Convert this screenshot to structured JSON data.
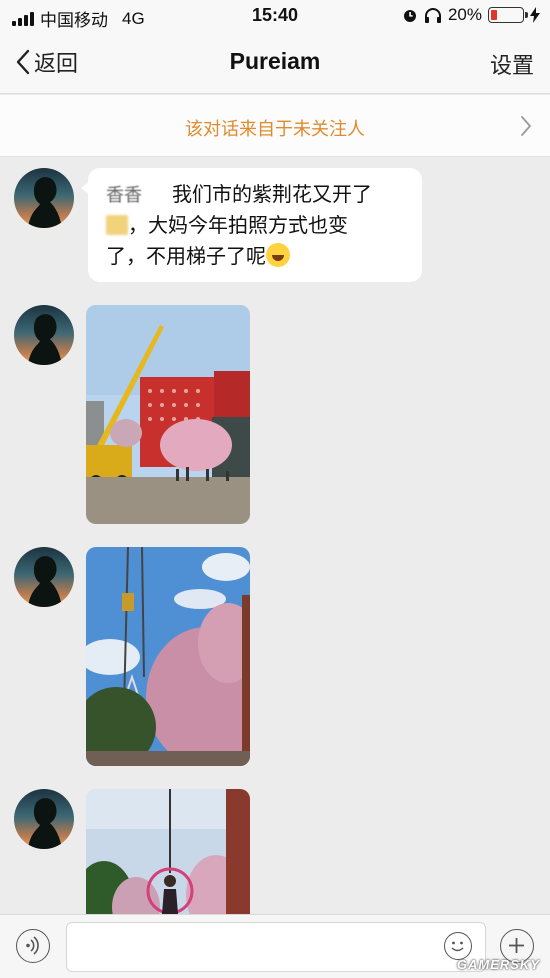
{
  "status_bar": {
    "carrier": "中国移动",
    "network": "4G",
    "time": "15:40",
    "battery": "20%",
    "battery_level": 0.2
  },
  "nav": {
    "back_label": "返回",
    "title": "Pureiam",
    "settings_label": "设置"
  },
  "notice": {
    "text": "该对话来自于未关注人"
  },
  "messages": [
    {
      "type": "text",
      "sender_name_blurred": "香香",
      "line1": "我们市的紫荆花又开了",
      "line2": "，大妈今年拍照方式也变",
      "line3": "了，不用梯子了呢",
      "emoji_end": "laugh-cry-emoji"
    },
    {
      "type": "image",
      "description_icon": "photo-crane-building"
    },
    {
      "type": "image",
      "description_icon": "photo-crane-hook-trees"
    },
    {
      "type": "image",
      "description_icon": "photo-woman-in-ring"
    }
  ],
  "input_bar": {
    "placeholder": ""
  },
  "watermark": "GAMERSKY",
  "colors": {
    "notice_text": "#e08a2c",
    "battery_low": "#e0352b",
    "bubble": "#ffffff",
    "chat_bg": "#ececec"
  }
}
